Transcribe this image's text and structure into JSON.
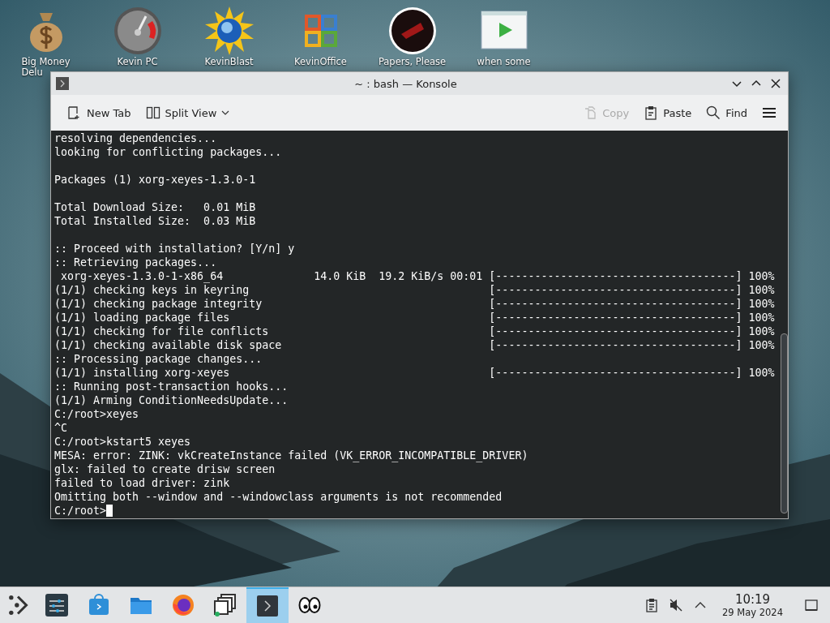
{
  "desktop_icons": [
    {
      "kind": "moneybag",
      "label_lines": [
        "Big Money",
        "Delu"
      ]
    },
    {
      "kind": "gauge",
      "label_lines": [
        "Kevin PC"
      ]
    },
    {
      "kind": "sunglobe",
      "label_lines": [
        "KevinBlast"
      ]
    },
    {
      "kind": "office",
      "label_lines": [
        "KevinOffice"
      ]
    },
    {
      "kind": "redcircle",
      "label_lines": [
        "Papers, Please"
      ]
    },
    {
      "kind": "player",
      "label_lines": [
        "when some"
      ]
    }
  ],
  "window": {
    "title": "~ : bash — Konsole",
    "toolbar": [
      {
        "kind": "new-tab",
        "label": "New Tab",
        "disabled": false
      },
      {
        "kind": "split-view",
        "label": "Split View",
        "disabled": false
      },
      {
        "kind": "copy",
        "label": "Copy",
        "disabled": true
      },
      {
        "kind": "paste",
        "label": "Paste",
        "disabled": false
      },
      {
        "kind": "find",
        "label": "Find",
        "disabled": false
      },
      {
        "kind": "menu"
      }
    ],
    "terminal": {
      "cursor_visible": true,
      "blocks": [
        {
          "lines": [
            "resolving dependencies...",
            "looking for conflicting packages..."
          ]
        },
        {
          "lines": [
            "Packages (1) xorg-xeyes-1.3.0-1"
          ]
        },
        {
          "lines": [
            "Total Download Size:   0.01 MiB",
            "Total Installed Size:  0.03 MiB"
          ]
        },
        {
          "lines": [
            ":: Proceed with installation? [Y/n] y",
            ":: Retrieving packages...",
            " xorg-xeyes-1.3.0-1-x86_64              14.0 KiB  19.2 KiB/s 00:01 [-------------------------------------] 100%",
            "(1/1) checking keys in keyring                                     [-------------------------------------] 100%",
            "(1/1) checking package integrity                                   [-------------------------------------] 100%",
            "(1/1) loading package files                                        [-------------------------------------] 100%",
            "(1/1) checking for file conflicts                                  [-------------------------------------] 100%",
            "(1/1) checking available disk space                                [-------------------------------------] 100%",
            ":: Processing package changes...",
            "(1/1) installing xorg-xeyes                                        [-------------------------------------] 100%",
            ":: Running post-transaction hooks...",
            "(1/1) Arming ConditionNeedsUpdate...",
            "C:/root>xeyes",
            "^C",
            "C:/root>kstart5 xeyes",
            "MESA: error: ZINK: vkCreateInstance failed (VK_ERROR_INCOMPATIBLE_DRIVER)",
            "glx: failed to create drisw screen",
            "failed to load driver: zink",
            "Omitting both --window and --windowclass arguments is not recommended",
            "C:/root>"
          ]
        }
      ]
    }
  },
  "taskbar": {
    "tasks": [
      {
        "kind": "launcher",
        "selected": false
      },
      {
        "kind": "settings",
        "selected": false
      },
      {
        "kind": "discover",
        "selected": false
      },
      {
        "kind": "files",
        "selected": false
      },
      {
        "kind": "firefox",
        "selected": false
      },
      {
        "kind": "windows",
        "selected": false
      },
      {
        "kind": "konsole",
        "selected": true
      },
      {
        "kind": "xeyes",
        "selected": false
      }
    ],
    "tray": [
      {
        "kind": "clipboard"
      },
      {
        "kind": "muted-speaker"
      },
      {
        "kind": "chevron"
      }
    ],
    "clock": {
      "time": "10:19",
      "date": "29 May 2024"
    }
  }
}
